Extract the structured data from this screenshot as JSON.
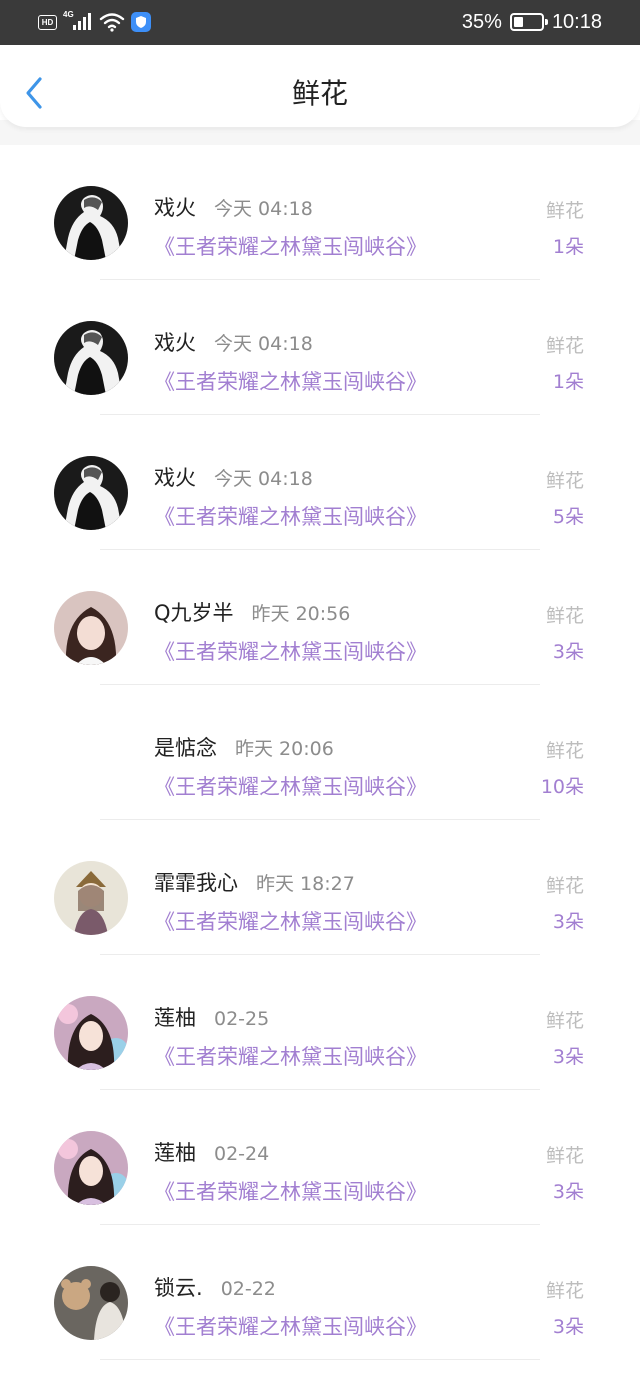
{
  "status_bar": {
    "hd": "HD",
    "network": "4G",
    "battery_percent": "35%",
    "battery_level": 0.35,
    "time": "10:18"
  },
  "nav": {
    "title": "鲜花",
    "back_icon": "chevron-left-icon"
  },
  "colors": {
    "accent_purple": "#a27fd1",
    "back_blue": "#3e95e8",
    "status_bar_bg": "#3a3a3a"
  },
  "records": [
    {
      "name": "戏火",
      "time": "今天 04:18",
      "work": "《王者荣耀之林黛玉闯峡谷》",
      "gift": "鲜花",
      "count": "1朵",
      "avatar": "dark-silhouette"
    },
    {
      "name": "戏火",
      "time": "今天 04:18",
      "work": "《王者荣耀之林黛玉闯峡谷》",
      "gift": "鲜花",
      "count": "1朵",
      "avatar": "dark-silhouette"
    },
    {
      "name": "戏火",
      "time": "今天 04:18",
      "work": "《王者荣耀之林黛玉闯峡谷》",
      "gift": "鲜花",
      "count": "5朵",
      "avatar": "dark-silhouette"
    },
    {
      "name": "Q九岁半",
      "time": "昨天 20:56",
      "work": "《王者荣耀之林黛玉闯峡谷》",
      "gift": "鲜花",
      "count": "3朵",
      "avatar": "girl-photo"
    },
    {
      "name": "是惦念",
      "time": "昨天 20:06",
      "work": "《王者荣耀之林黛玉闯峡谷》",
      "gift": "鲜花",
      "count": "10朵",
      "avatar": "none"
    },
    {
      "name": "霏霏我心",
      "time": "昨天 18:27",
      "work": "《王者荣耀之林黛玉闯峡谷》",
      "gift": "鲜花",
      "count": "3朵",
      "avatar": "anime-girl"
    },
    {
      "name": "莲柚",
      "time": "02-25",
      "work": "《王者荣耀之林黛玉闯峡谷》",
      "gift": "鲜花",
      "count": "3朵",
      "avatar": "girl-colorful"
    },
    {
      "name": "莲柚",
      "time": "02-24",
      "work": "《王者荣耀之林黛玉闯峡谷》",
      "gift": "鲜花",
      "count": "3朵",
      "avatar": "girl-colorful"
    },
    {
      "name": "锁云.",
      "time": "02-22",
      "work": "《王者荣耀之林黛玉闯峡谷》",
      "gift": "鲜花",
      "count": "3朵",
      "avatar": "person-bear"
    }
  ]
}
